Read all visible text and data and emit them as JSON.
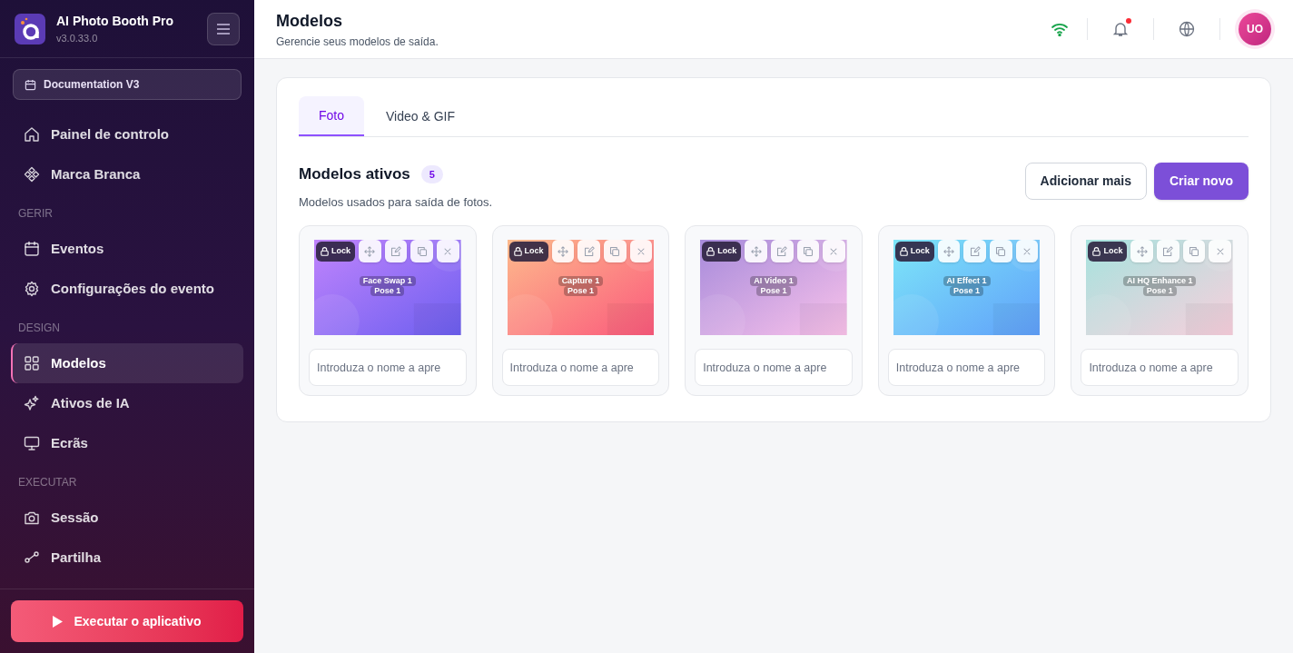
{
  "app": {
    "name": "AI Photo Booth Pro",
    "version": "v3.0.33.0"
  },
  "event_selector": {
    "label": "Documentation V3"
  },
  "sidebar": {
    "items": [
      {
        "kind": "item",
        "label": "Painel de controlo",
        "selected": false
      },
      {
        "kind": "item",
        "label": "Marca Branca",
        "selected": false
      },
      {
        "kind": "section",
        "label": "GERIR"
      },
      {
        "kind": "item",
        "label": "Eventos",
        "selected": false
      },
      {
        "kind": "item",
        "label": "Configurações do evento",
        "selected": false
      },
      {
        "kind": "section",
        "label": "DESIGN"
      },
      {
        "kind": "item",
        "label": "Modelos",
        "selected": true
      },
      {
        "kind": "item",
        "label": "Ativos de IA",
        "selected": false
      },
      {
        "kind": "item",
        "label": "Ecrãs",
        "selected": false
      },
      {
        "kind": "section",
        "label": "EXECUTAR"
      },
      {
        "kind": "item",
        "label": "Sessão",
        "selected": false
      },
      {
        "kind": "item",
        "label": "Partilha",
        "selected": false
      }
    ],
    "run_button": "Executar o aplicativo"
  },
  "header": {
    "title": "Modelos",
    "subtitle": "Gerencie seus modelos de saída.",
    "notification": true,
    "avatar": "UO"
  },
  "tabs": [
    {
      "label": "Foto",
      "selected": true
    },
    {
      "label": "Video & GIF",
      "selected": false
    }
  ],
  "section": {
    "title": "Modelos ativos",
    "count": "5",
    "subtitle": "Modelos usados para saída de fotos.",
    "buttons": [
      "Adicionar mais",
      "Criar novo"
    ]
  },
  "templates": [
    {
      "badge": "Lock",
      "lines": [
        "Face Swap 1",
        "Pose 1"
      ],
      "placeholder": "Introduza o nome a apre"
    },
    {
      "badge": "Lock",
      "lines": [
        "Capture 1",
        "Pose 1"
      ],
      "placeholder": "Introduza o nome a apre"
    },
    {
      "badge": "Lock",
      "lines": [
        "AI Video 1",
        "Pose 1"
      ],
      "placeholder": "Introduza o nome a apre"
    },
    {
      "badge": "Lock",
      "lines": [
        "AI Effect 1",
        "Pose 1"
      ],
      "placeholder": "Introduza o nome a apre"
    },
    {
      "badge": "Lock",
      "lines": [
        "AI HQ Enhance 1",
        "Pose 1"
      ],
      "placeholder": "Introduza o nome a apre"
    }
  ]
}
